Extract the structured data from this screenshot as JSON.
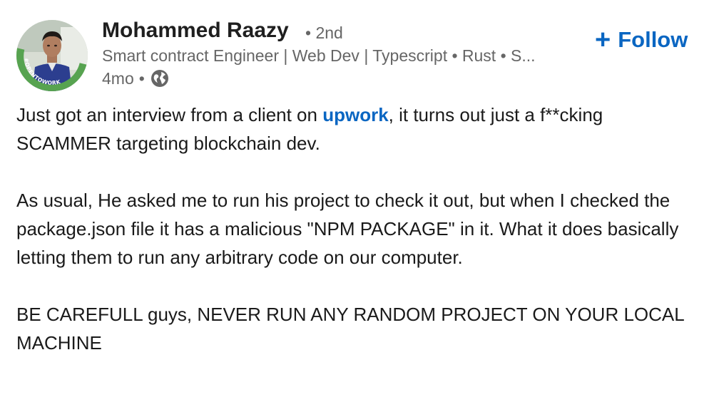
{
  "actor": {
    "name": "Mohammed Raazy",
    "degree": "• 2nd",
    "headline": "Smart contract Engineer | Web Dev | Typescript • Rust • S...",
    "time": "4mo",
    "separator": "•",
    "visibility_icon": "globe-icon",
    "avatar_badge_text": "#OPENTOWORK",
    "badge_color": "#57a350"
  },
  "follow": {
    "icon": "plus-icon",
    "plus": "+",
    "label": "Follow",
    "color": "#0a66c2"
  },
  "post": {
    "p1_before": "Just got an interview from a client on ",
    "p1_mention": "upwork",
    "p1_after": ", it turns out just a f**cking SCAMMER targeting blockchain dev.",
    "p2": "As usual, He asked me to run his project to check it out, but when I checked the package.json file it has a malicious \"NPM PACKAGE\" in it. What it does basically letting them to run any arbitrary code on our computer.",
    "p3": "BE CAREFULL guys, NEVER RUN ANY RANDOM PROJECT ON YOUR LOCAL MACHINE"
  }
}
